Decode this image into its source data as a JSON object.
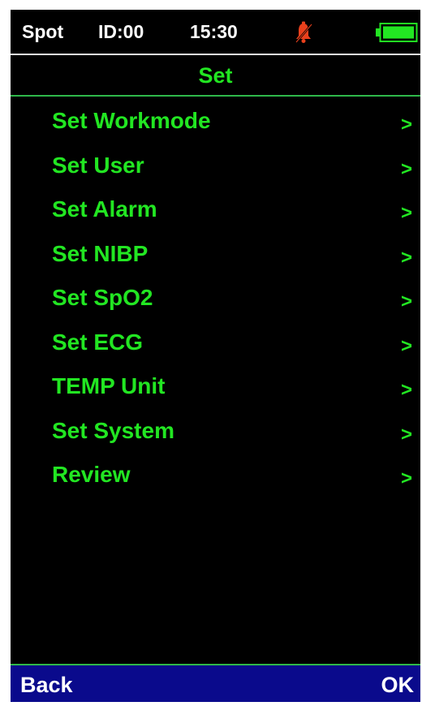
{
  "status_bar": {
    "mode": "Spot",
    "id": "ID:00",
    "time": "15:30",
    "alarm_icon": "alarm-muted-bell-icon",
    "battery_icon": "battery-full-icon"
  },
  "title": "Set",
  "menu": {
    "items": [
      {
        "label": "Set Workmode",
        "arrow": ">"
      },
      {
        "label": "Set User",
        "arrow": ">"
      },
      {
        "label": "Set Alarm",
        "arrow": ">"
      },
      {
        "label": "Set NIBP",
        "arrow": ">"
      },
      {
        "label": "Set SpO2",
        "arrow": ">"
      },
      {
        "label": "Set ECG",
        "arrow": ">"
      },
      {
        "label": "TEMP Unit",
        "arrow": ">"
      },
      {
        "label": "Set System",
        "arrow": ">"
      },
      {
        "label": "Review",
        "arrow": ">"
      }
    ]
  },
  "softkeys": {
    "back": "Back",
    "ok": "OK"
  },
  "colors": {
    "screen_background": "#000000",
    "menu_text": "#22e622",
    "status_text": "#ffffff",
    "alarm_icon": "#e8401c",
    "battery_fill": "#22e622",
    "softkey_bar": "#0a0a8c"
  }
}
